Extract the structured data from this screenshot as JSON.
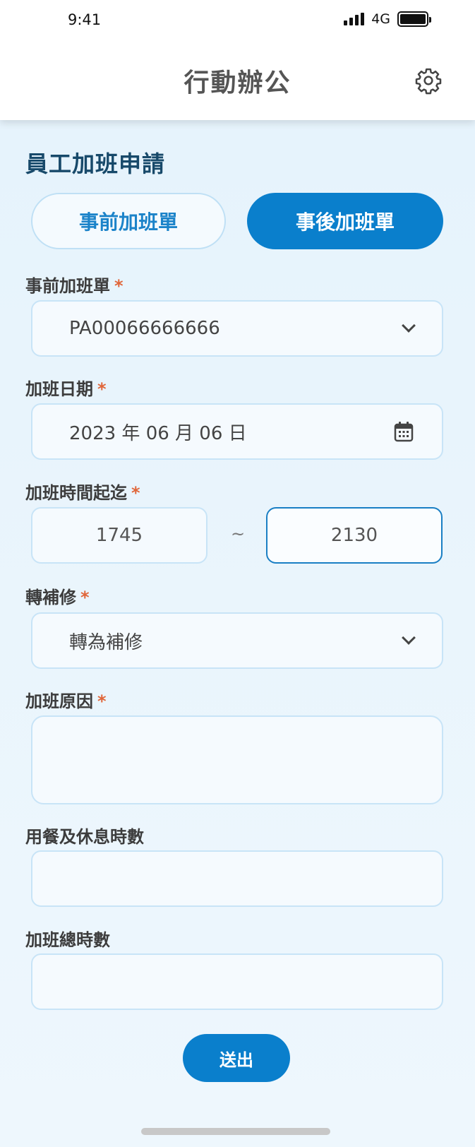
{
  "status_bar": {
    "time": "9:41",
    "network": "4G"
  },
  "header": {
    "title": "行動辦公",
    "settings_icon": "gear-icon"
  },
  "page": {
    "heading": "員工加班申請"
  },
  "tabs": [
    {
      "label": "事前加班單",
      "active": false
    },
    {
      "label": "事後加班單",
      "active": true
    }
  ],
  "form": {
    "pre_overtime": {
      "label": "事前加班單",
      "required_mark": "*",
      "value": "PA00066666666"
    },
    "date": {
      "label": "加班日期",
      "required_mark": "*",
      "value": "2023 年 06 月 06 日"
    },
    "time_range": {
      "label": "加班時間起迄",
      "required_mark": "*",
      "start": "1745",
      "separator": "~",
      "end": "2130"
    },
    "compensation": {
      "label": "轉補修",
      "required_mark": "*",
      "value": "轉為補修"
    },
    "reason": {
      "label": "加班原因",
      "required_mark": "*",
      "value": ""
    },
    "meal_rest_hours": {
      "label": "用餐及休息時數",
      "value": ""
    },
    "total_hours": {
      "label": "加班總時數",
      "value": ""
    }
  },
  "submit_label": "送出",
  "colors": {
    "primary": "#0a7fcc",
    "heading": "#17496a",
    "required": "#e0663a",
    "field_border": "#c8e4f7"
  }
}
